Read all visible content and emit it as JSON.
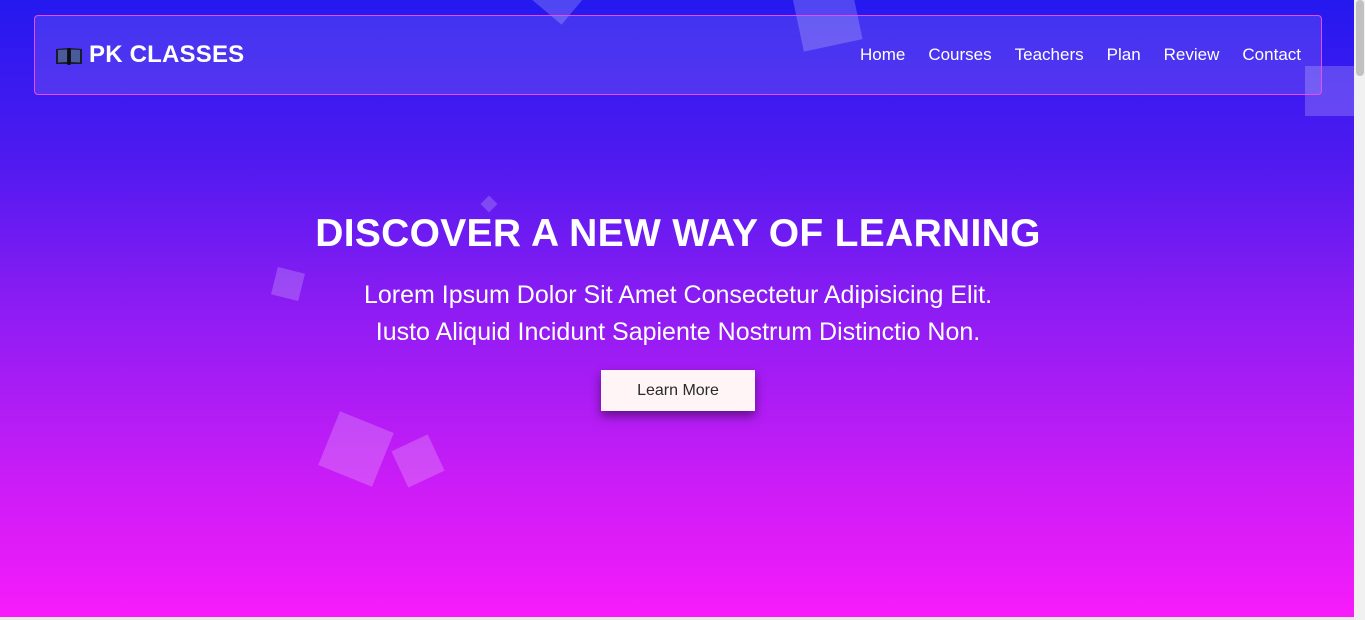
{
  "brand": {
    "icon": "open-book-icon",
    "name": "PK CLASSES"
  },
  "nav": {
    "items": [
      {
        "label": "Home"
      },
      {
        "label": "Courses"
      },
      {
        "label": "Teachers"
      },
      {
        "label": "Plan"
      },
      {
        "label": "Review"
      },
      {
        "label": "Contact"
      }
    ]
  },
  "hero": {
    "title": "DISCOVER A NEW WAY OF LEARNING",
    "subtitle_line1": "Lorem Ipsum Dolor Sit Amet Consectetur Adipisicing Elit.",
    "subtitle_line2": "Iusto Aliquid Incidunt Sapiente Nostrum Distinctio Non.",
    "cta_label": "Learn More"
  },
  "colors": {
    "gradient_top": "#2419ef",
    "gradient_bottom": "#f81bfb",
    "nav_border": "#e64bf4",
    "button_bg": "#fff5f6"
  }
}
